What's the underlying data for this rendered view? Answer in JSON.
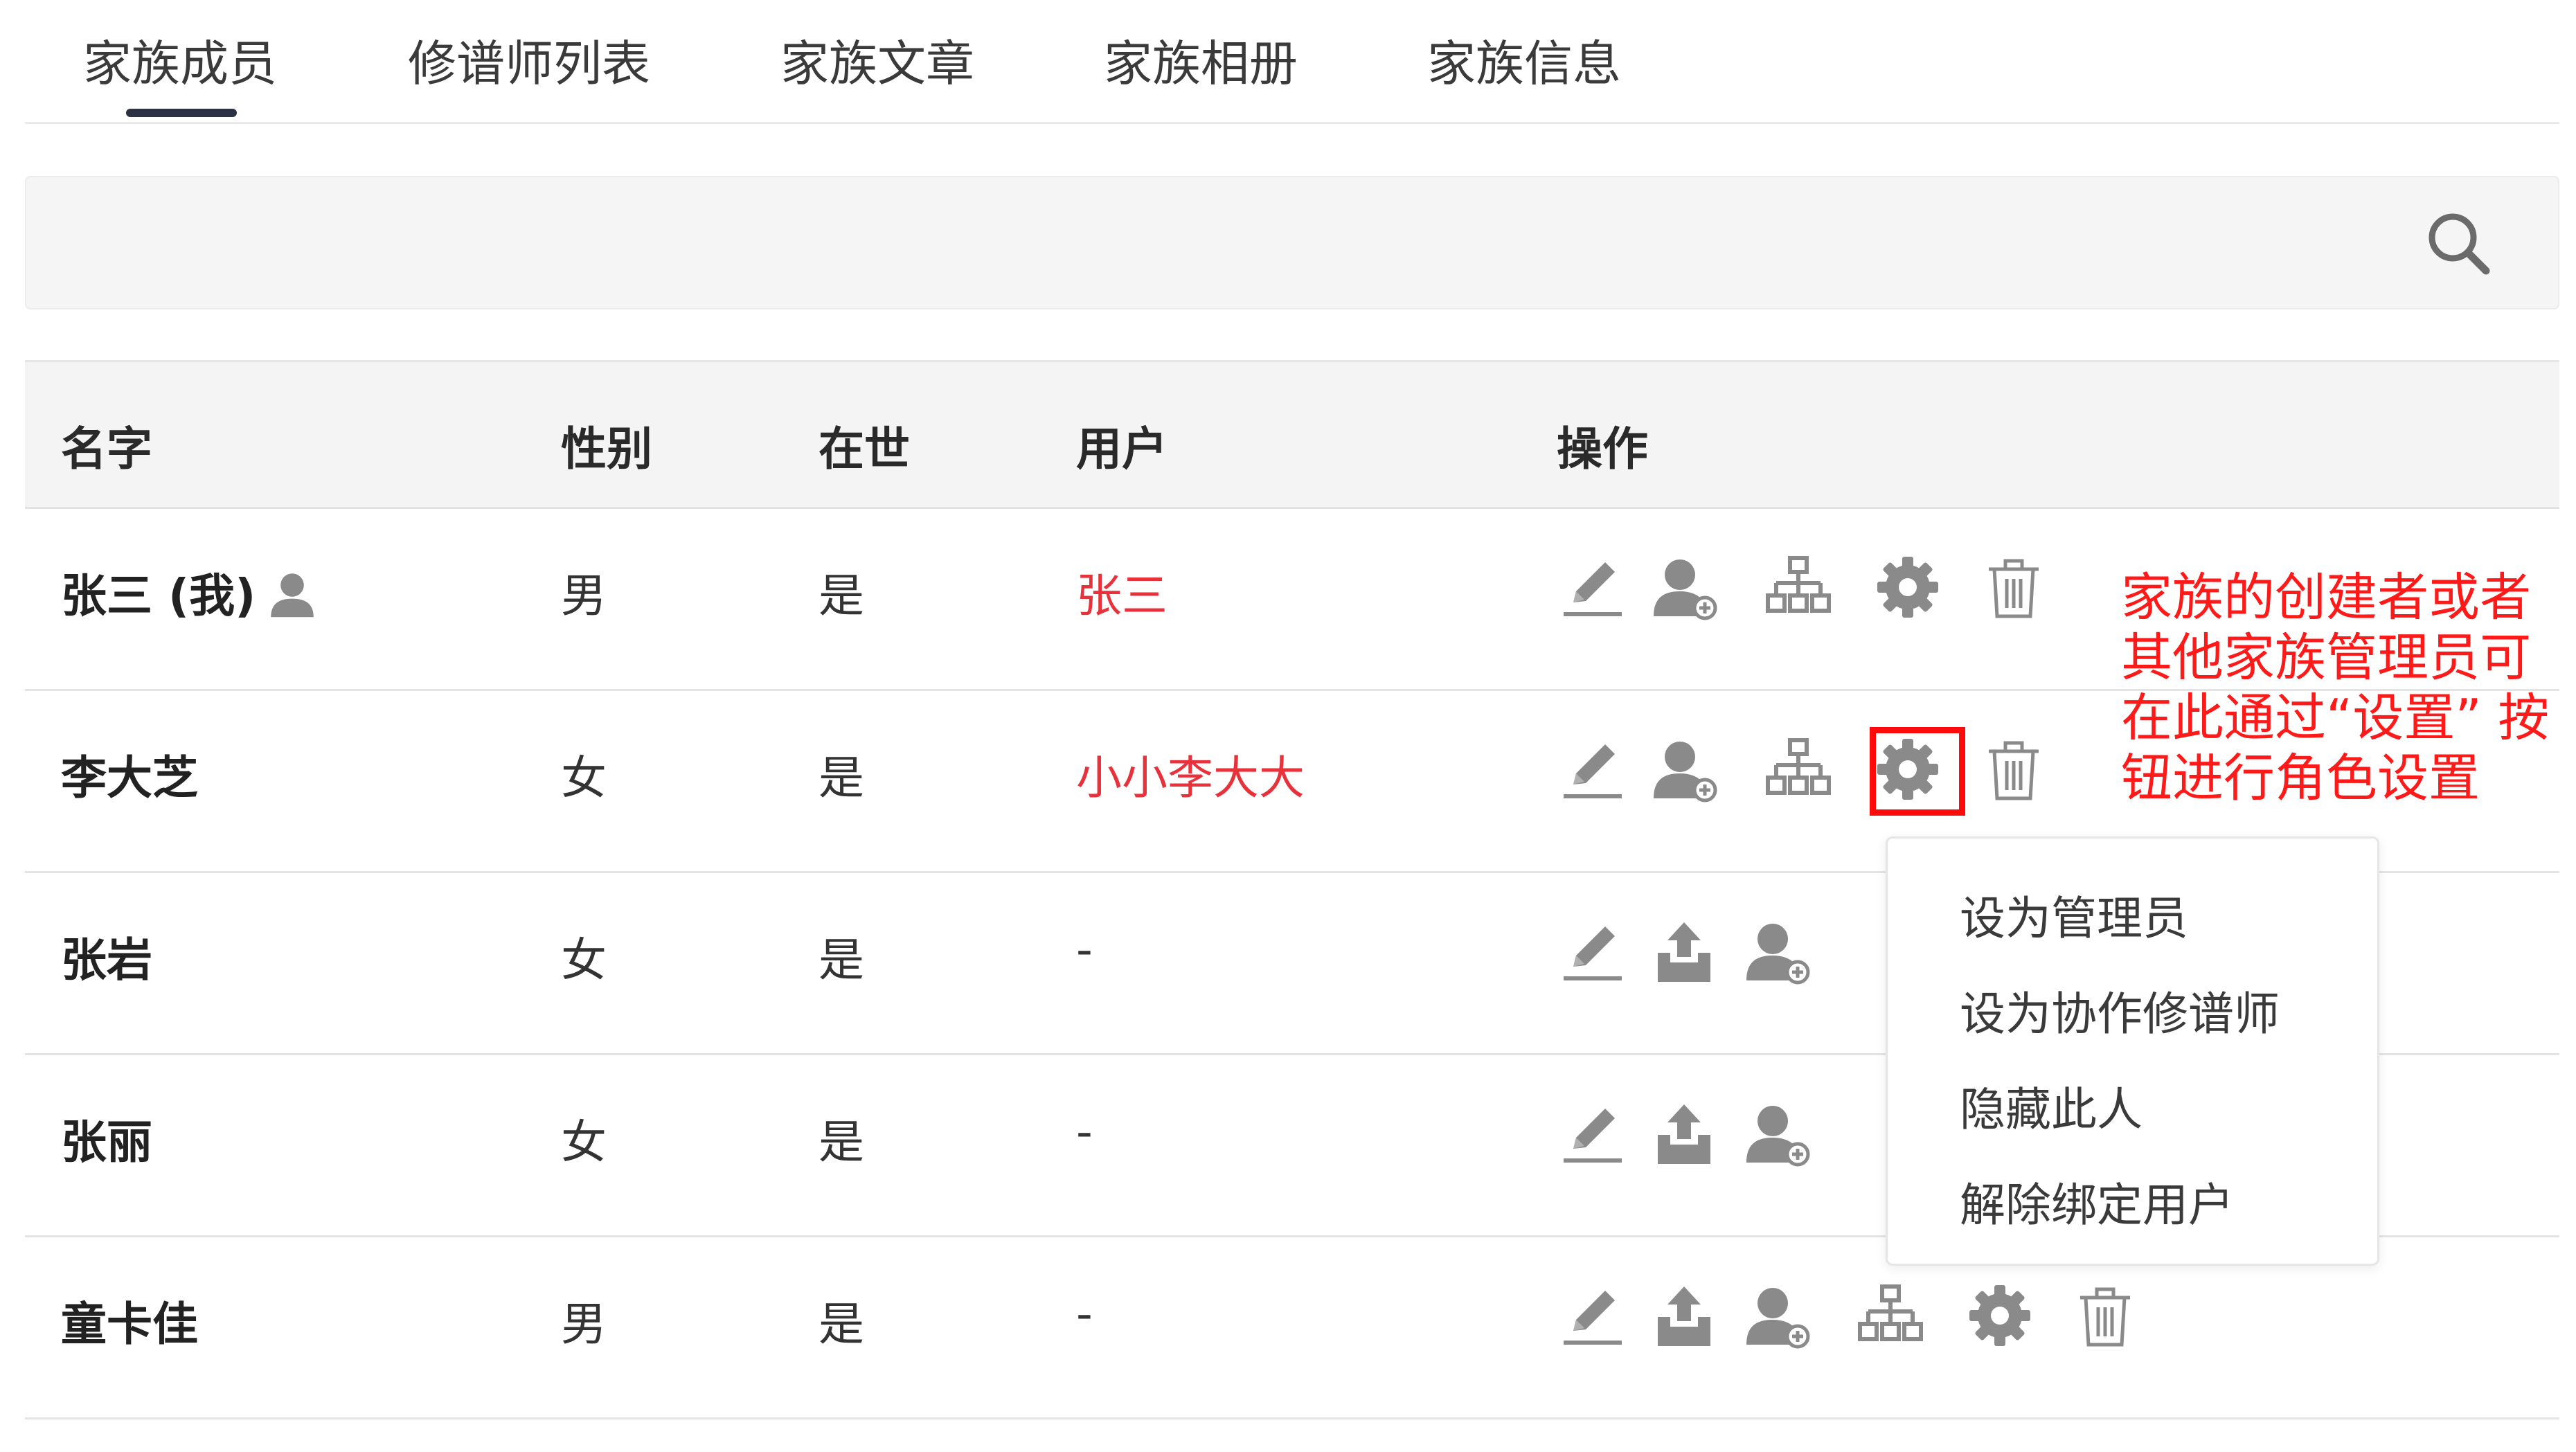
{
  "tabs": [
    {
      "label": "家族成员",
      "active": true
    },
    {
      "label": "修谱师列表"
    },
    {
      "label": "家族文章"
    },
    {
      "label": "家族相册"
    },
    {
      "label": "家族信息"
    }
  ],
  "search": {
    "placeholder": "",
    "value": ""
  },
  "table": {
    "headers": [
      "名字",
      "性别",
      "在世",
      "用户",
      "操作"
    ],
    "rows": [
      {
        "name": "张三 (我)",
        "gender": "男",
        "alive": "是",
        "user": "张三"
      },
      {
        "name": "李大芝",
        "gender": "女",
        "alive": "是",
        "user": "小小李大大"
      },
      {
        "name": "张岩",
        "gender": "女",
        "alive": "是",
        "user": "-"
      },
      {
        "name": "张丽",
        "gender": "女",
        "alive": "是",
        "user": "-"
      },
      {
        "name": "童卡佳",
        "gender": "男",
        "alive": "是",
        "user": "-"
      }
    ]
  },
  "dropdown": {
    "items": [
      "设为管理员",
      "设为协作修谱师",
      "隐藏此人",
      "解除绑定用户"
    ]
  },
  "annotation": {
    "lines": [
      "家族的创建者或者",
      "其他家族管理员可",
      "在此通过“设置” 按",
      "钮进行角色设置"
    ]
  },
  "colors": {
    "accent": "#2b3244",
    "user_link": "#e8323b",
    "highlight": "#ff0a0a",
    "icon": "#8a8a8a"
  }
}
